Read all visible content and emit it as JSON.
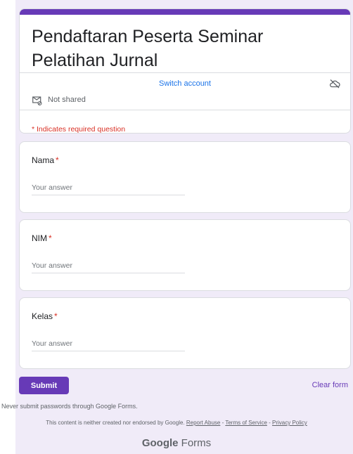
{
  "form": {
    "title": "Pendaftaran Peserta Seminar Pelatihan Jurnal",
    "switch_account": "Switch account",
    "not_shared": "Not shared",
    "required_note": "* Indicates required question"
  },
  "questions": [
    {
      "label": "Nama",
      "required_mark": "*",
      "placeholder": "Your answer"
    },
    {
      "label": "NIM",
      "required_mark": "*",
      "placeholder": "Your answer"
    },
    {
      "label": "Kelas",
      "required_mark": "*",
      "placeholder": "Your answer"
    }
  ],
  "actions": {
    "submit": "Submit",
    "clear_form": "Clear form"
  },
  "footer": {
    "never_submit": "Never submit passwords through Google Forms.",
    "disclaimer": "This content is neither created nor endorsed by Google.",
    "report_abuse": "Report Abuse",
    "sep1": " - ",
    "terms": "Terms of Service",
    "sep2": " - ",
    "privacy": "Privacy Policy",
    "logo_google": "Google",
    "logo_forms": " Forms"
  },
  "icons": {
    "cloud": "cloud-off-icon",
    "mail": "mail-not-shared-icon"
  },
  "colors": {
    "accent": "#673ab7",
    "background": "#f0ebf8",
    "required": "#d93025",
    "link": "#1a73e8"
  }
}
